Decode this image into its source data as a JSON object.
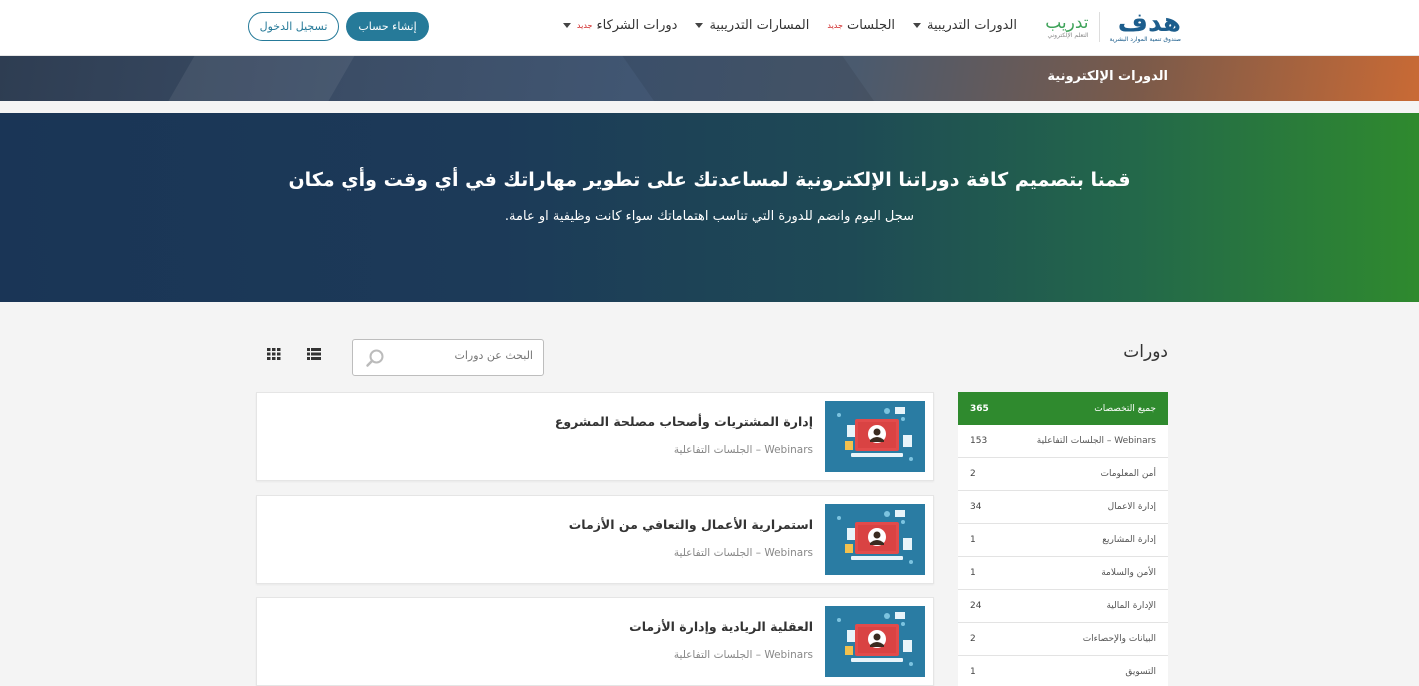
{
  "header": {
    "logo_main": "هدف",
    "logo_sub": "صندوق تنمية الموارد البشرية",
    "logo_tadreeb": "تدريب",
    "logo_tadreeb_sub": "التعلم الإلكتروني",
    "nav": [
      {
        "label": "الدورات التدريبية",
        "has_caret": true,
        "badge": ""
      },
      {
        "label": "الجلسات",
        "has_caret": false,
        "badge": "جديد"
      },
      {
        "label": "المسارات التدريبية",
        "has_caret": true,
        "badge": ""
      },
      {
        "label": "دورات الشركاء",
        "has_caret": true,
        "badge": "جديد"
      }
    ],
    "register_label": "إنشاء حساب",
    "login_label": "تسجيل الدخول"
  },
  "banner": {
    "title": "الدورات الإلكترونية"
  },
  "hero": {
    "title": "قمنا بتصميم كافة دوراتنا الإلكترونية لمساعدتك على تطوير مهاراتك في أي وقت وأي مكان",
    "subtitle": "سجل اليوم وانضم للدورة التي تناسب اهتماماتك سواء كانت وظيفية او عامة."
  },
  "main": {
    "section_title": "دورات",
    "search_placeholder": "البحث عن دورات"
  },
  "sidebar": {
    "items": [
      {
        "label": "جميع التخصصات",
        "count": "365",
        "active": true
      },
      {
        "label": "Webinars – الجلسات التفاعلية",
        "count": "153",
        "active": false
      },
      {
        "label": "أمن المعلومات",
        "count": "2",
        "active": false
      },
      {
        "label": "إدارة الاعمال",
        "count": "34",
        "active": false
      },
      {
        "label": "إدارة المشاريع",
        "count": "1",
        "active": false
      },
      {
        "label": "الأمن والسلامة",
        "count": "1",
        "active": false
      },
      {
        "label": "الإدارة المالية",
        "count": "24",
        "active": false
      },
      {
        "label": "البيانات والإحصاءات",
        "count": "2",
        "active": false
      },
      {
        "label": "التسويق",
        "count": "1",
        "active": false
      }
    ]
  },
  "courses": [
    {
      "title": "إدارة المشتريات وأصحاب مصلحة المشروع",
      "category": "Webinars – الجلسات التفاعلية"
    },
    {
      "title": "استمرارية الأعمال والتعافي من الأزمات",
      "category": "Webinars – الجلسات التفاعلية"
    },
    {
      "title": "العقلية الريادية وإدارة الأزمات",
      "category": "Webinars – الجلسات التفاعلية"
    }
  ],
  "colors": {
    "primary": "#267a99",
    "active_green": "#2f8a2e",
    "hero_dark": "#1a3556",
    "thumb_bg": "#2a7ca3"
  },
  "icons": [
    "search-icon",
    "grid-view-icon",
    "list-view-icon",
    "caret-down-icon"
  ]
}
